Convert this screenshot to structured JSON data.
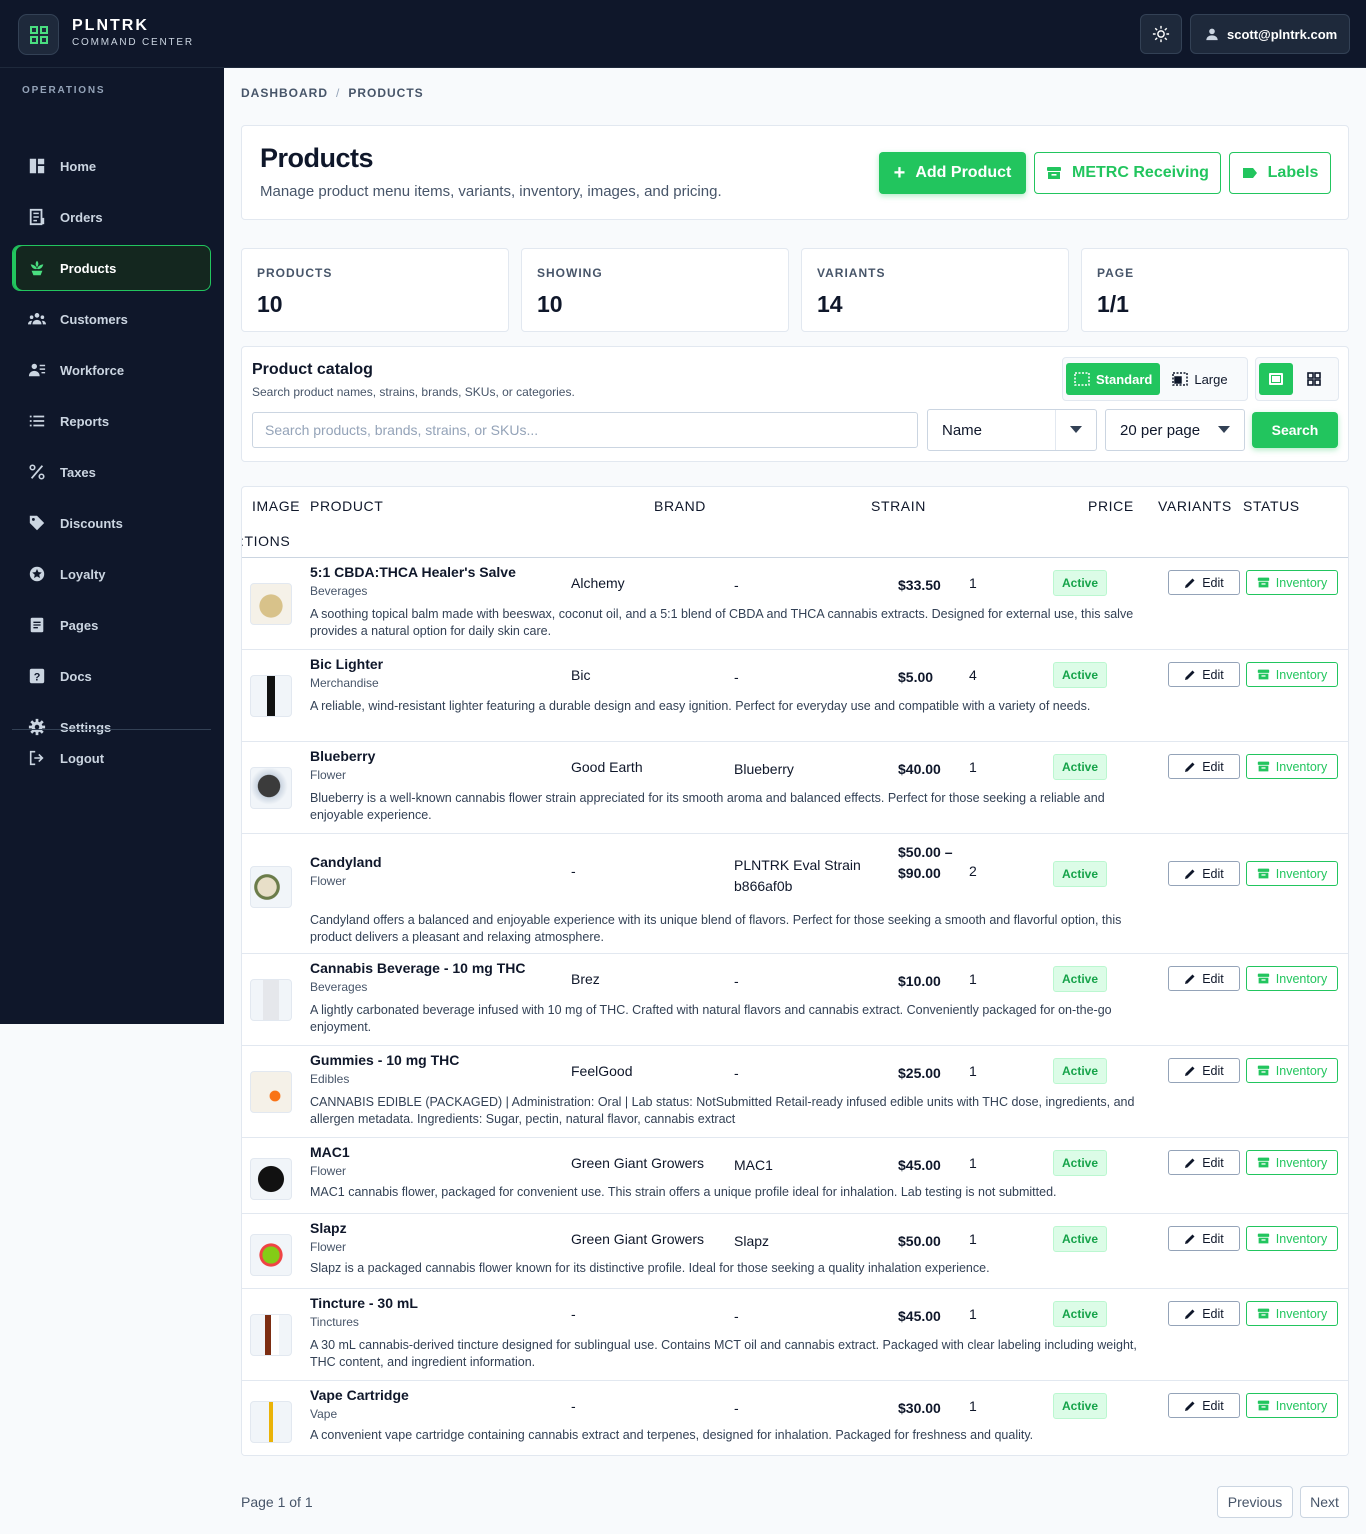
{
  "app": {
    "name": "PLNTRK",
    "subtitle": "COMMAND CENTER",
    "user": "scott@plntrk.com"
  },
  "sidebar": {
    "section": "OPERATIONS",
    "items": [
      {
        "label": "Home",
        "icon": "home-icon"
      },
      {
        "label": "Orders",
        "icon": "orders-icon"
      },
      {
        "label": "Products",
        "icon": "products-icon",
        "active": true
      },
      {
        "label": "Customers",
        "icon": "customers-icon"
      },
      {
        "label": "Workforce",
        "icon": "workforce-icon"
      },
      {
        "label": "Reports",
        "icon": "reports-icon"
      },
      {
        "label": "Taxes",
        "icon": "percent-icon"
      },
      {
        "label": "Discounts",
        "icon": "tag-icon"
      },
      {
        "label": "Loyalty",
        "icon": "star-icon"
      },
      {
        "label": "Pages",
        "icon": "pages-icon"
      },
      {
        "label": "Docs",
        "icon": "help-icon"
      },
      {
        "label": "Settings",
        "icon": "gear-icon"
      }
    ],
    "logout": "Logout"
  },
  "breadcrumb": {
    "root": "DASHBOARD",
    "sep": "/",
    "current": "PRODUCTS"
  },
  "header": {
    "title": "Products",
    "subtitle": "Manage product menu items, variants, inventory, images, and pricing.",
    "add_label": "Add Product",
    "metrc_label": "METRC Receiving",
    "labels_label": "Labels"
  },
  "stats": [
    {
      "label": "PRODUCTS",
      "value": "10"
    },
    {
      "label": "SHOWING",
      "value": "10"
    },
    {
      "label": "VARIANTS",
      "value": "14"
    },
    {
      "label": "PAGE",
      "value": "1/1"
    }
  ],
  "catalog": {
    "title": "Product catalog",
    "subtitle": "Search product names, strains, brands, SKUs, or categories.",
    "standard_label": "Standard",
    "large_label": "Large",
    "search_placeholder": "Search products, brands, strains, or SKUs...",
    "sort_value": "Name",
    "per_page_value": "20 per page",
    "search_label": "Search"
  },
  "table": {
    "headers": {
      "image": "IMAGE",
      "product": "PRODUCT",
      "brand": "BRAND",
      "strain": "STRAIN",
      "price": "PRICE",
      "variants": "VARIANTS",
      "status": "STATUS",
      "actions": ":TIONS"
    },
    "edit_label": "Edit",
    "inventory_label": "Inventory",
    "rows": [
      {
        "name": "5:1 CBDA:THCA Healer's Salve",
        "category": "Beverages",
        "brand": "Alchemy",
        "strain": "-",
        "price": "$33.50",
        "variants": "1",
        "status": "Active",
        "description": "A soothing topical balm made with beeswax, coconut oil, and a 5:1 blend of CBDA and THCA cannabis extracts. Designed for external use, this salve provides a natural option for daily skin care."
      },
      {
        "name": "Bic Lighter",
        "category": "Merchandise",
        "brand": "Bic",
        "strain": "-",
        "price": "$5.00",
        "variants": "4",
        "status": "Active",
        "description": "A reliable, wind-resistant lighter featuring a durable design and easy ignition. Perfect for everyday use and compatible with a variety of needs."
      },
      {
        "name": "Blueberry",
        "category": "Flower",
        "brand": "Good Earth",
        "strain": "Blueberry",
        "price": "$40.00",
        "variants": "1",
        "status": "Active",
        "description": "Blueberry is a well-known cannabis flower strain appreciated for its smooth aroma and balanced effects. Perfect for those seeking a reliable and enjoyable experience."
      },
      {
        "name": "Candyland",
        "category": "Flower",
        "brand": "-",
        "strain": "PLNTRK Eval Strain b866af0b",
        "price": "$50.00 – $90.00",
        "variants": "2",
        "status": "Active",
        "description": "Candyland offers a balanced and enjoyable experience with its unique blend of flavors. Perfect for those seeking a smooth and flavorful option, this product delivers a pleasant and relaxing atmosphere."
      },
      {
        "name": "Cannabis Beverage - 10 mg THC",
        "category": "Beverages",
        "brand": "Brez",
        "strain": "-",
        "price": "$10.00",
        "variants": "1",
        "status": "Active",
        "description": "A lightly carbonated beverage infused with 10 mg of THC. Crafted with natural flavors and cannabis extract. Conveniently packaged for on-the-go enjoyment."
      },
      {
        "name": "Gummies - 10 mg THC",
        "category": "Edibles",
        "brand": "FeelGood",
        "strain": "-",
        "price": "$25.00",
        "variants": "1",
        "status": "Active",
        "description": "CANNABIS EDIBLE (PACKAGED) | Administration: Oral | Lab status: NotSubmitted Retail-ready infused edible units with THC dose, ingredients, and allergen metadata. Ingredients: Sugar, pectin, natural flavor, cannabis extract"
      },
      {
        "name": "MAC1",
        "category": "Flower",
        "brand": "Green Giant Growers",
        "strain": "MAC1",
        "price": "$45.00",
        "variants": "1",
        "status": "Active",
        "description": "MAC1 cannabis flower, packaged for convenient use. This strain offers a unique profile ideal for inhalation. Lab testing is not submitted."
      },
      {
        "name": "Slapz",
        "category": "Flower",
        "brand": "Green Giant Growers",
        "strain": "Slapz",
        "price": "$50.00",
        "variants": "1",
        "status": "Active",
        "description": "Slapz is a packaged cannabis flower known for its distinctive profile. Ideal for those seeking a quality inhalation experience."
      },
      {
        "name": "Tincture - 30 mL",
        "category": "Tinctures",
        "brand": "-",
        "strain": "-",
        "price": "$45.00",
        "variants": "1",
        "status": "Active",
        "description": "A 30 mL cannabis-derived tincture designed for sublingual use. Contains MCT oil and cannabis extract. Packaged with clear labeling including weight, THC content, and ingredient information."
      },
      {
        "name": "Vape Cartridge",
        "category": "Vape",
        "brand": "-",
        "strain": "-",
        "price": "$30.00",
        "variants": "1",
        "status": "Active",
        "description": "A convenient vape cartridge containing cannabis extract and terpenes, designed for inhalation. Packaged for freshness and quality."
      }
    ]
  },
  "pagination": {
    "label": "Page 1 of 1",
    "previous": "Previous",
    "next": "Next"
  },
  "colors": {
    "accent": "#22c55e",
    "sidebar_bg": "#0f172a",
    "page_bg": "#f8fafc"
  }
}
